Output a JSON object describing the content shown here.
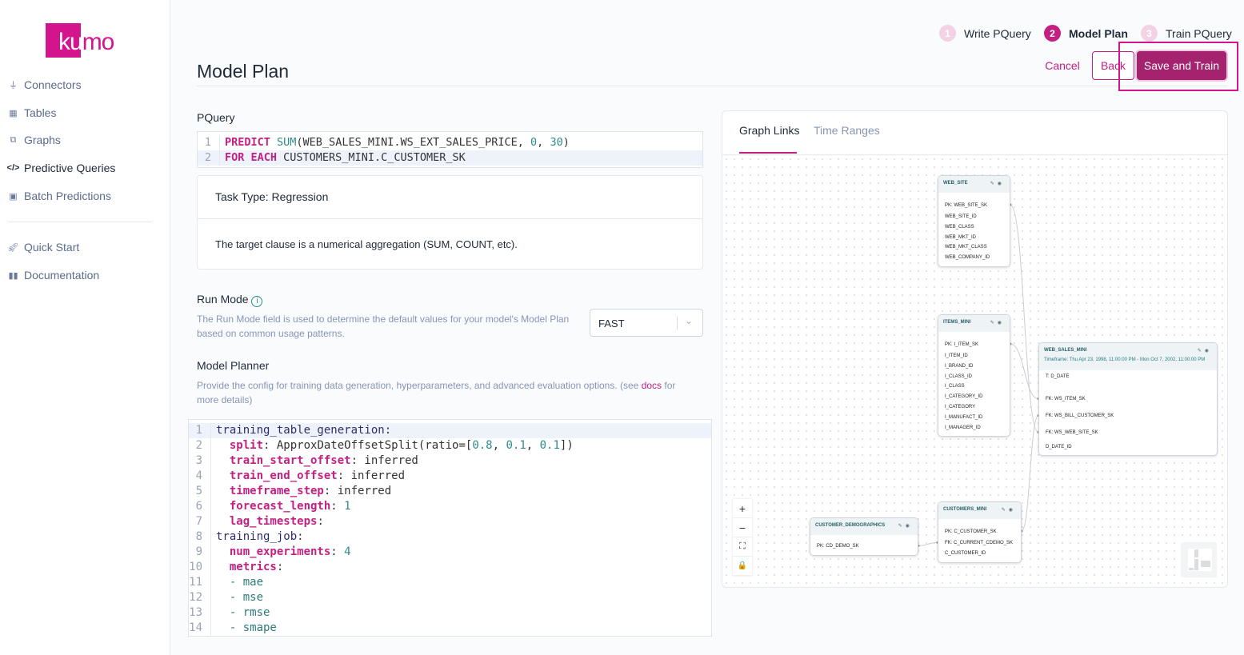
{
  "brand": {
    "logo_text": "kumo",
    "color": "#d4148c"
  },
  "sidebar": {
    "items": [
      {
        "label": "Connectors",
        "icon": "plug-icon"
      },
      {
        "label": "Tables",
        "icon": "table-icon"
      },
      {
        "label": "Graphs",
        "icon": "graph-icon"
      },
      {
        "label": "Predictive Queries",
        "icon": "code-icon",
        "active": true
      },
      {
        "label": "Batch Predictions",
        "icon": "play-square-icon"
      }
    ],
    "secondary": [
      {
        "label": "Quick Start",
        "icon": "rocket-icon"
      },
      {
        "label": "Documentation",
        "icon": "book-icon"
      }
    ]
  },
  "header": {
    "title": "Model Plan",
    "steps": [
      {
        "num": "1",
        "label": "Write PQuery"
      },
      {
        "num": "2",
        "label": "Model Plan",
        "active": true
      },
      {
        "num": "3",
        "label": "Train PQuery"
      }
    ],
    "cancel": "Cancel",
    "back": "Back",
    "save": "Save and Train"
  },
  "pquery": {
    "label": "PQuery",
    "lines": [
      [
        {
          "t": "PREDICT ",
          "c": "kw"
        },
        {
          "t": "SUM",
          "c": "fn"
        },
        {
          "t": "(WEB_SALES_MINI.WS_EXT_SALES_PRICE, ",
          "c": "pl"
        },
        {
          "t": "0",
          "c": "num"
        },
        {
          "t": ", ",
          "c": "pl"
        },
        {
          "t": "30",
          "c": "num"
        },
        {
          "t": ")",
          "c": "pl"
        }
      ],
      [
        {
          "t": "FOR EACH ",
          "c": "kw"
        },
        {
          "t": "CUSTOMERS_MINI.C_CUSTOMER_SK",
          "c": "pl"
        }
      ]
    ]
  },
  "task": {
    "title": "Task Type: Regression",
    "description": "The target clause is a numerical aggregation (SUM, COUNT, etc)."
  },
  "run_mode": {
    "label": "Run Mode",
    "help": "The Run Mode field is used to determine the default values for your model's Model Plan based on common usage patterns.",
    "value": "FAST"
  },
  "planner": {
    "label": "Model Planner",
    "help_before": "Provide the config for training data generation, hyperparameters, and advanced evaluation options. (see ",
    "help_link": "docs",
    "help_after": " for more details)",
    "lines": [
      [
        {
          "t": "training_table_generation",
          "c": "top"
        },
        {
          "t": ":",
          "c": "pl"
        }
      ],
      [
        {
          "t": "  "
        },
        {
          "t": "split",
          "c": "key"
        },
        {
          "t": ": ApproxDateOffsetSplit(ratio=[",
          "c": "pl"
        },
        {
          "t": "0.8",
          "c": "num"
        },
        {
          "t": ", ",
          "c": "pl"
        },
        {
          "t": "0.1",
          "c": "num"
        },
        {
          "t": ", ",
          "c": "pl"
        },
        {
          "t": "0.1",
          "c": "num"
        },
        {
          "t": "])",
          "c": "pl"
        }
      ],
      [
        {
          "t": "  "
        },
        {
          "t": "train_start_offset",
          "c": "key"
        },
        {
          "t": ": inferred",
          "c": "pl"
        }
      ],
      [
        {
          "t": "  "
        },
        {
          "t": "train_end_offset",
          "c": "key"
        },
        {
          "t": ": inferred",
          "c": "pl"
        }
      ],
      [
        {
          "t": "  "
        },
        {
          "t": "timeframe_step",
          "c": "key"
        },
        {
          "t": ": inferred",
          "c": "pl"
        }
      ],
      [
        {
          "t": "  "
        },
        {
          "t": "forecast_length",
          "c": "key"
        },
        {
          "t": ": ",
          "c": "pl"
        },
        {
          "t": "1",
          "c": "num"
        }
      ],
      [
        {
          "t": "  "
        },
        {
          "t": "lag_timesteps",
          "c": "key"
        },
        {
          "t": ":",
          "c": "pl"
        }
      ],
      [
        {
          "t": "training_job",
          "c": "top"
        },
        {
          "t": ":",
          "c": "pl"
        }
      ],
      [
        {
          "t": "  "
        },
        {
          "t": "num_experiments",
          "c": "key"
        },
        {
          "t": ": ",
          "c": "pl"
        },
        {
          "t": "4",
          "c": "num"
        }
      ],
      [
        {
          "t": "  "
        },
        {
          "t": "metrics",
          "c": "key"
        },
        {
          "t": ":",
          "c": "pl"
        }
      ],
      [
        {
          "t": "  - mae",
          "c": "item"
        }
      ],
      [
        {
          "t": "  - mse",
          "c": "item"
        }
      ],
      [
        {
          "t": "  - rmse",
          "c": "item"
        }
      ],
      [
        {
          "t": "  - smape",
          "c": "item"
        }
      ]
    ]
  },
  "graph": {
    "tabs": [
      "Graph Links",
      "Time Ranges"
    ],
    "controls": [
      "+",
      "−",
      "⛶",
      "🔒"
    ],
    "nodes": [
      {
        "name": "WEB_SITE",
        "rows": [
          "PK: WEB_SITE_SK",
          "WEB_SITE_ID",
          "WEB_CLASS",
          "WEB_MKT_ID",
          "WEB_MKT_CLASS",
          "WEB_COMPANY_ID"
        ]
      },
      {
        "name": "ITEMS_MINI",
        "rows": [
          "PK: I_ITEM_SK",
          "I_ITEM_ID",
          "I_BRAND_ID",
          "I_CLASS_ID",
          "I_CLASS",
          "I_CATEGORY_ID",
          "I_CATEGORY",
          "I_MANUFACT_ID",
          "I_MANAGER_ID"
        ]
      },
      {
        "name": "WEB_SALES_MINI",
        "timeframe": "Timeframe: Thu Apr 23, 1998, 11:00:00 PM - Mon Oct 7, 2002, 11:00:00 PM",
        "rows": [
          "T: D_DATE",
          "",
          "FK: WS_ITEM_SK",
          "FK: WS_BILL_CUSTOMER_SK",
          "FK: WS_WEB_SITE_SK",
          "D_DATE_ID"
        ]
      },
      {
        "name": "CUSTOMERS_MINI",
        "rows": [
          "PK: C_CUSTOMER_SK",
          "FK: C_CURRENT_CDEMO_SK",
          "C_CUSTOMER_ID"
        ]
      },
      {
        "name": "CUSTOMER_DEMOGRAPHICS",
        "rows": [
          "PK: CD_DEMO_SK"
        ]
      }
    ],
    "links": [
      [
        "WEB_SITE.WEB_SITE_SK",
        "WEB_SALES_MINI.WS_WEB_SITE_SK"
      ],
      [
        "ITEMS_MINI.I_ITEM_SK",
        "WEB_SALES_MINI.WS_ITEM_SK"
      ],
      [
        "CUSTOMERS_MINI.C_CUSTOMER_SK",
        "WEB_SALES_MINI.WS_BILL_CUSTOMER_SK"
      ],
      [
        "CUSTOMER_DEMOGRAPHICS.CD_DEMO_SK",
        "CUSTOMERS_MINI.C_CURRENT_CDEMO_SK"
      ]
    ]
  }
}
